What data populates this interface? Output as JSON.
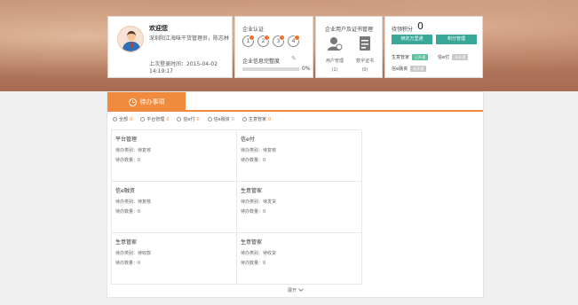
{
  "user": {
    "welcome": "欢迎您",
    "role": "深圳阳江海味干货管理员，陈志林",
    "last_login_label": "上次登录时间：",
    "last_login_time": "2015-04-02 14:19:17"
  },
  "cert": {
    "title": "企业认证",
    "icons": [
      "1",
      "2",
      "3",
      "4"
    ],
    "completeness_label": "企业信息完整度",
    "completeness_value": "0%",
    "completeness_fraction": 0
  },
  "users": {
    "title": "企业用户及证书管理",
    "user_mgmt": "用户管理",
    "user_count": "(1)",
    "cert_label": "数字证书",
    "cert_count": "(0)"
  },
  "points": {
    "label": "待领积分",
    "value": "0",
    "btn_mall": "绑定万里通",
    "btn_manage": "积分管理",
    "accounts": [
      {
        "name": "生意管家",
        "badge": "已开通",
        "state": "active",
        "name2": "信e付",
        "badge2": "未开通",
        "state2": "inactive"
      },
      {
        "name": "信e融资",
        "badge": "未开通",
        "state": "inactive"
      }
    ]
  },
  "tab": {
    "label": "待办事项"
  },
  "filters": [
    {
      "label": "全部",
      "count": "0",
      "checked": true
    },
    {
      "label": "平台管理",
      "count": "0"
    },
    {
      "label": "信e付",
      "count": "0"
    },
    {
      "label": "信e融资",
      "count": "0"
    },
    {
      "label": "生意管家",
      "count": "0"
    }
  ],
  "tasks": [
    {
      "name": "平台管理",
      "type": "待办类别：待复核",
      "qty": "待办数量：0"
    },
    {
      "name": "信e付",
      "type": "待办类别：待复核",
      "qty": "待办数量：0"
    },
    {
      "name": "信e融资",
      "type": "待办类别：待复核",
      "qty": "待办数量：0"
    },
    {
      "name": "生意管家",
      "type": "待办类别：待发货",
      "qty": "待办数量：0"
    },
    {
      "name": "生意管家",
      "type": "待办类别：待收款",
      "qty": "待办数量：0"
    },
    {
      "name": "生意管家",
      "type": "待办类别：待收货",
      "qty": "待办数量：0"
    }
  ],
  "expand_label": "展开",
  "colors": {
    "accent": "#f08a3c",
    "teal": "#3aa898",
    "badge_green": "#5cc09a"
  }
}
